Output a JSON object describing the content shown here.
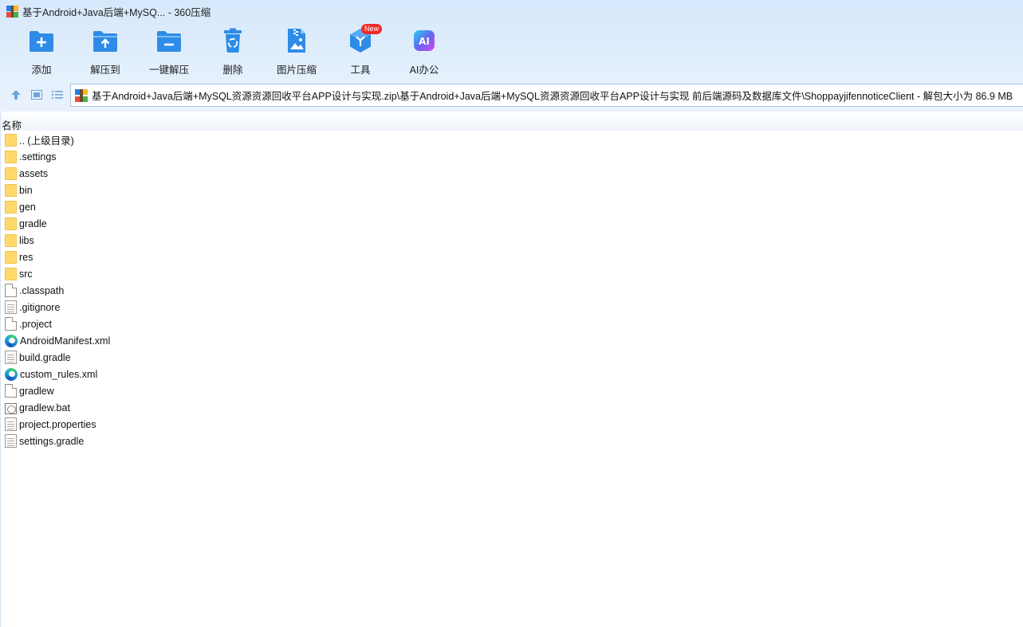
{
  "window": {
    "title": "基于Android+Java后端+MySQ... - 360压缩"
  },
  "toolbar": {
    "buttons": [
      {
        "label": "添加",
        "icon": "add-folder-icon"
      },
      {
        "label": "解压到",
        "icon": "extract-to-icon"
      },
      {
        "label": "一键解压",
        "icon": "one-click-extract-icon"
      },
      {
        "label": "删除",
        "icon": "recycle-delete-icon"
      },
      {
        "label": "图片压缩",
        "icon": "image-compress-icon"
      },
      {
        "label": "工具",
        "icon": "tools-cube-icon"
      },
      {
        "label": "AI办公",
        "icon": "ai-office-icon"
      }
    ],
    "badge": "New"
  },
  "address": {
    "path": "基于Android+Java后端+MySQL资源资源回收平台APP设计与实现.zip\\基于Android+Java后端+MySQL资源资源回收平台APP设计与实现 前后端源码及数据库文件\\ShoppayjifennoticeClient - 解包大小为 86.9 MB"
  },
  "list": {
    "column_name": "名称",
    "items": [
      {
        "name": ".. (上级目录)",
        "type": "folder"
      },
      {
        "name": ".settings",
        "type": "folder"
      },
      {
        "name": "assets",
        "type": "folder"
      },
      {
        "name": "bin",
        "type": "folder"
      },
      {
        "name": "gen",
        "type": "folder"
      },
      {
        "name": "gradle",
        "type": "folder"
      },
      {
        "name": "libs",
        "type": "folder"
      },
      {
        "name": "res",
        "type": "folder"
      },
      {
        "name": "src",
        "type": "folder"
      },
      {
        "name": ".classpath",
        "type": "file"
      },
      {
        "name": ".gitignore",
        "type": "text"
      },
      {
        "name": ".project",
        "type": "file"
      },
      {
        "name": "AndroidManifest.xml",
        "type": "xml"
      },
      {
        "name": "build.gradle",
        "type": "text"
      },
      {
        "name": "custom_rules.xml",
        "type": "xml"
      },
      {
        "name": "gradlew",
        "type": "file"
      },
      {
        "name": "gradlew.bat",
        "type": "bat"
      },
      {
        "name": "project.properties",
        "type": "text"
      },
      {
        "name": "settings.gradle",
        "type": "text"
      }
    ]
  },
  "colors": {
    "accent": "#2e8ce8",
    "folder": "#ffd96b",
    "badge": "#f22a2a"
  }
}
